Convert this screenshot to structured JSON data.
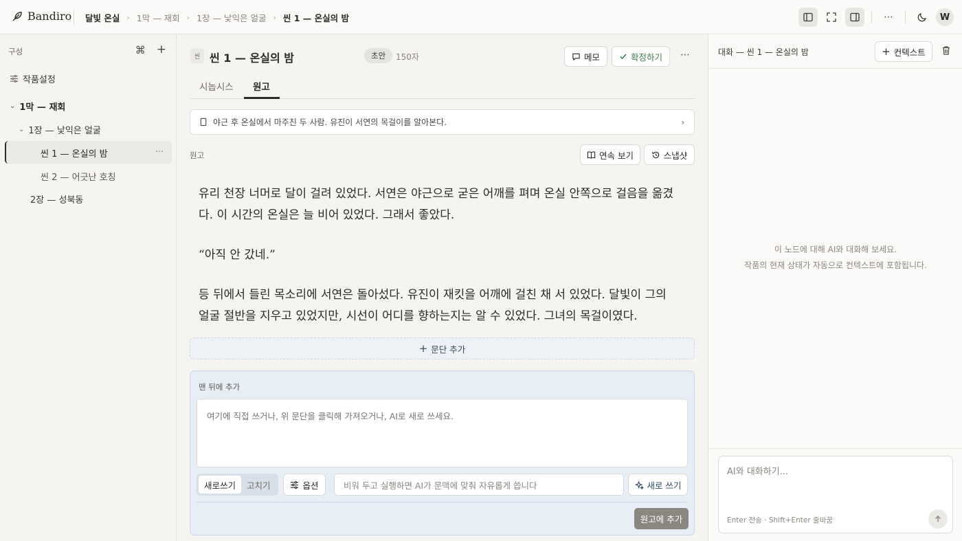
{
  "app": {
    "name": "Bandiro"
  },
  "breadcrumb": {
    "project": "달빛 온실",
    "act": "1막 — 재회",
    "chapter": "1장 — 낯익은 얼굴",
    "scene": "씬 1 — 온실의 밤"
  },
  "topbar": {
    "user_initial": "W"
  },
  "sidebar": {
    "heading": "구성",
    "settings_label": "작품설정",
    "tree": {
      "act1": "1막 — 재회",
      "chapter1": "1장 — 낯익은 얼굴",
      "scene1": "씬 1 — 온실의 밤",
      "scene2": "씬 2 — 어긋난 호칭",
      "chapter2": "2장 — 성북동"
    }
  },
  "scene": {
    "tag": "씬",
    "title": "씬 1 — 온실의 밤",
    "status": "초안",
    "char_count": "150자",
    "memo_label": "메모",
    "confirm_label": "확정하기"
  },
  "tabs": {
    "synopsis": "시놉시스",
    "draft": "원고"
  },
  "synopsis_summary": "야근 후 온실에서 마주친 두 사람. 유진이 서연의 목걸이를 알아본다.",
  "draft": {
    "label": "원고",
    "continuous_label": "연속 보기",
    "snapshot_label": "스냅샷",
    "paragraphs": [
      "유리 천장 너머로 달이 걸려 있었다. 서연은 야근으로 굳은 어깨를 펴며 온실 안쪽으로 걸음을 옮겼다. 이 시간의 온실은 늘 비어 있었다. 그래서 좋았다.",
      "“아직 안 갔네.”",
      "등 뒤에서 들린 목소리에 서연은 돌아섰다. 유진이 재킷을 어깨에 걸친 채 서 있었다. 달빛이 그의 얼굴 절반을 지우고 있었지만, 시선이 어디를 향하는지는 알 수 있었다. 그녀의 목걸이였다."
    ],
    "add_paragraph_label": "문단 추가"
  },
  "composer": {
    "label": "맨 뒤에 추가",
    "placeholder": "여기에 직접 쓰거나, 위 문단을 클릭해 가져오거나, AI로 새로 쓰세요.",
    "mode_new": "새로쓰기",
    "mode_edit": "고치기",
    "options_label": "옵션",
    "ai_prompt_placeholder": "비워 두고 실행하면 AI가 문맥에 맞춰 자유롭게 씁니다",
    "write_label": "새로 쓰기",
    "add_to_draft_label": "원고에 추가"
  },
  "chat_panel": {
    "title": "대화 — 씬 1 — 온실의 밤",
    "context_label": "컨텍스트",
    "empty_line1": "이 노드에 대해 AI와 대화해 보세요.",
    "empty_line2": "작품의 현재 상태가 자동으로 컨텍스트에 포함됩니다.",
    "input_placeholder": "AI와 대화하기...",
    "hint": "Enter 전송 · Shift+Enter 줄바꿈"
  },
  "icons": [
    "feather-icon",
    "chevron-right-icon",
    "sidebar-left-icon",
    "fullscreen-icon",
    "sidebar-right-icon",
    "more-icon",
    "moon-icon",
    "command-icon",
    "plus-icon",
    "sliders-icon",
    "chevron-down-icon",
    "message-icon",
    "check-icon",
    "book-icon",
    "history-icon",
    "sparkle-icon",
    "trash-icon",
    "arrow-up-icon"
  ]
}
